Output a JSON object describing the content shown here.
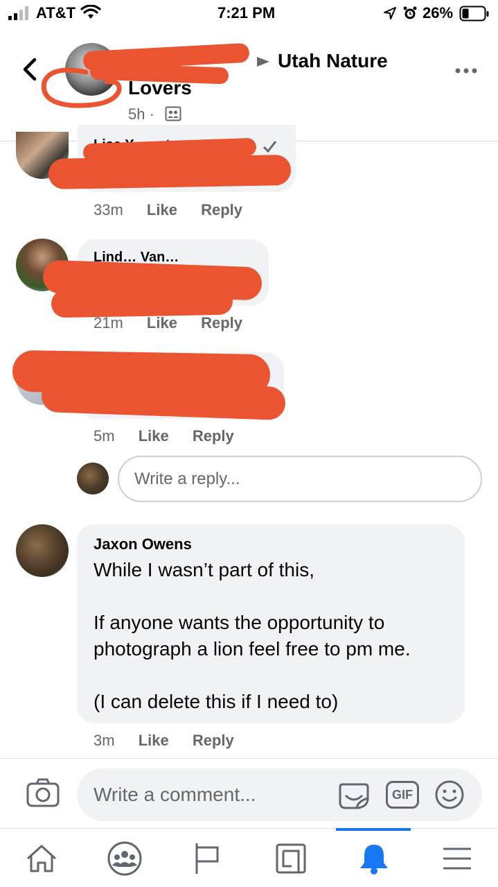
{
  "status_bar": {
    "carrier": "AT&T",
    "time": "7:21 PM",
    "battery": "26%"
  },
  "header": {
    "group_name_line1": "Utah Nature",
    "group_name_line2": "Lovers",
    "timestamp": "5h ·",
    "back_icon": "chevron-left-icon",
    "more_icon": "more-dots-icon"
  },
  "comments": [
    {
      "author_partial": "Lisa Y… …ton",
      "time": "33m",
      "like": "Like",
      "reply": "Reply"
    },
    {
      "author_partial": "Lind… Van…",
      "time": "21m",
      "like": "Like",
      "reply": "Reply"
    },
    {
      "author_partial": "",
      "time": "5m",
      "like": "Like",
      "reply": "Reply"
    }
  ],
  "reply_box": {
    "placeholder": "Write a reply..."
  },
  "main_comment": {
    "author": "Jaxon Owens",
    "text": "While I wasn’t part of this,\n\nIf anyone wants the opportunity to photograph a lion feel free to pm me.\n\n(I can delete this if I need to)",
    "time": "3m",
    "like": "Like",
    "reply": "Reply"
  },
  "composer": {
    "placeholder": "Write a comment...",
    "gif_label": "GIF"
  },
  "nav": {
    "items": [
      "home-icon",
      "groups-icon",
      "pages-flag-icon",
      "news-icon",
      "notifications-bell-icon",
      "menu-icon"
    ],
    "active_index": 4,
    "accent_color": "#1877f2"
  }
}
